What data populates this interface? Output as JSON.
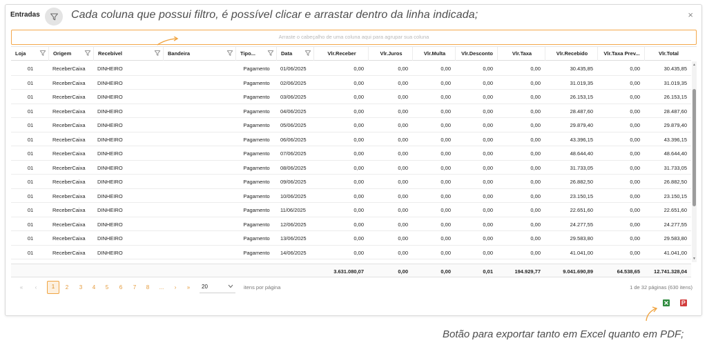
{
  "window": {
    "title": "Entradas",
    "annotation_top": "Cada coluna que possui filtro, é possível clicar e arrastar dentro da linha indicada;",
    "close_label": "×"
  },
  "group_panel": {
    "placeholder": "Arraste o cabeçalho de uma coluna aqui para agrupar sua coluna"
  },
  "columns": [
    {
      "label": "Loja",
      "filter": true
    },
    {
      "label": "Origem",
      "filter": true
    },
    {
      "label": "Recebível",
      "filter": true
    },
    {
      "label": "Bandeira",
      "filter": true
    },
    {
      "label": "Tipo...",
      "filter": true
    },
    {
      "label": "Data",
      "filter": true
    },
    {
      "label": "Vlr.Receber",
      "filter": false
    },
    {
      "label": "Vlr.Juros",
      "filter": false
    },
    {
      "label": "Vlr.Multa",
      "filter": false
    },
    {
      "label": "Vlr.Desconto",
      "filter": false
    },
    {
      "label": "Vlr.Taxa",
      "filter": false
    },
    {
      "label": "Vlr.Recebido",
      "filter": false
    },
    {
      "label": "Vlr.Taxa Prev...",
      "filter": false
    },
    {
      "label": "Vlr.Total",
      "filter": false
    }
  ],
  "rows": [
    [
      "01",
      "ReceberCaixa",
      "DINHEIRO",
      "",
      "Pagamento",
      "01/06/2025",
      "0,00",
      "0,00",
      "0,00",
      "0,00",
      "0,00",
      "30.435,85",
      "0,00",
      "30.435,85"
    ],
    [
      "01",
      "ReceberCaixa",
      "DINHEIRO",
      "",
      "Pagamento",
      "02/06/2025",
      "0,00",
      "0,00",
      "0,00",
      "0,00",
      "0,00",
      "31.019,35",
      "0,00",
      "31.019,35"
    ],
    [
      "01",
      "ReceberCaixa",
      "DINHEIRO",
      "",
      "Pagamento",
      "03/06/2025",
      "0,00",
      "0,00",
      "0,00",
      "0,00",
      "0,00",
      "26.153,15",
      "0,00",
      "26.153,15"
    ],
    [
      "01",
      "ReceberCaixa",
      "DINHEIRO",
      "",
      "Pagamento",
      "04/06/2025",
      "0,00",
      "0,00",
      "0,00",
      "0,00",
      "0,00",
      "28.487,60",
      "0,00",
      "28.487,60"
    ],
    [
      "01",
      "ReceberCaixa",
      "DINHEIRO",
      "",
      "Pagamento",
      "05/06/2025",
      "0,00",
      "0,00",
      "0,00",
      "0,00",
      "0,00",
      "29.879,40",
      "0,00",
      "29.879,40"
    ],
    [
      "01",
      "ReceberCaixa",
      "DINHEIRO",
      "",
      "Pagamento",
      "06/06/2025",
      "0,00",
      "0,00",
      "0,00",
      "0,00",
      "0,00",
      "43.396,15",
      "0,00",
      "43.396,15"
    ],
    [
      "01",
      "ReceberCaixa",
      "DINHEIRO",
      "",
      "Pagamento",
      "07/06/2025",
      "0,00",
      "0,00",
      "0,00",
      "0,00",
      "0,00",
      "48.644,40",
      "0,00",
      "48.644,40"
    ],
    [
      "01",
      "ReceberCaixa",
      "DINHEIRO",
      "",
      "Pagamento",
      "08/06/2025",
      "0,00",
      "0,00",
      "0,00",
      "0,00",
      "0,00",
      "31.733,05",
      "0,00",
      "31.733,05"
    ],
    [
      "01",
      "ReceberCaixa",
      "DINHEIRO",
      "",
      "Pagamento",
      "09/06/2025",
      "0,00",
      "0,00",
      "0,00",
      "0,00",
      "0,00",
      "26.882,50",
      "0,00",
      "26.882,50"
    ],
    [
      "01",
      "ReceberCaixa",
      "DINHEIRO",
      "",
      "Pagamento",
      "10/06/2025",
      "0,00",
      "0,00",
      "0,00",
      "0,00",
      "0,00",
      "23.150,15",
      "0,00",
      "23.150,15"
    ],
    [
      "01",
      "ReceberCaixa",
      "DINHEIRO",
      "",
      "Pagamento",
      "11/06/2025",
      "0,00",
      "0,00",
      "0,00",
      "0,00",
      "0,00",
      "22.651,60",
      "0,00",
      "22.651,60"
    ],
    [
      "01",
      "ReceberCaixa",
      "DINHEIRO",
      "",
      "Pagamento",
      "12/06/2025",
      "0,00",
      "0,00",
      "0,00",
      "0,00",
      "0,00",
      "24.277,55",
      "0,00",
      "24.277,55"
    ],
    [
      "01",
      "ReceberCaixa",
      "DINHEIRO",
      "",
      "Pagamento",
      "13/06/2025",
      "0,00",
      "0,00",
      "0,00",
      "0,00",
      "0,00",
      "29.583,80",
      "0,00",
      "29.583,80"
    ],
    [
      "01",
      "ReceberCaixa",
      "DINHEIRO",
      "",
      "Pagamento",
      "14/06/2025",
      "0,00",
      "0,00",
      "0,00",
      "0,00",
      "0,00",
      "41.041,00",
      "0,00",
      "41.041,00"
    ]
  ],
  "totals": [
    "",
    "",
    "",
    "",
    "",
    "",
    "3.631.080,07",
    "0,00",
    "0,00",
    "0,01",
    "194.929,77",
    "9.041.690,89",
    "64.538,65",
    "12.741.328,04"
  ],
  "pager": {
    "first": "«",
    "prev": "‹",
    "next": "›",
    "last": "»",
    "pages": [
      "1",
      "2",
      "3",
      "4",
      "5",
      "6",
      "7",
      "8",
      "..."
    ],
    "active_page": "1",
    "page_size": "20",
    "per_page_label": "itens por página",
    "info": "1 de 32 páginas (630 itens)"
  },
  "export": {
    "excel_icon": "excel-export-icon",
    "pdf_icon": "pdf-export-icon",
    "excel_color": "#2e8b3e",
    "pdf_color": "#d23b3b"
  },
  "annotation_bottom": "Botão para exportar tanto em Excel quanto em PDF;",
  "colors": {
    "accent": "#f0a441",
    "annotation": "#4d4d4d"
  }
}
